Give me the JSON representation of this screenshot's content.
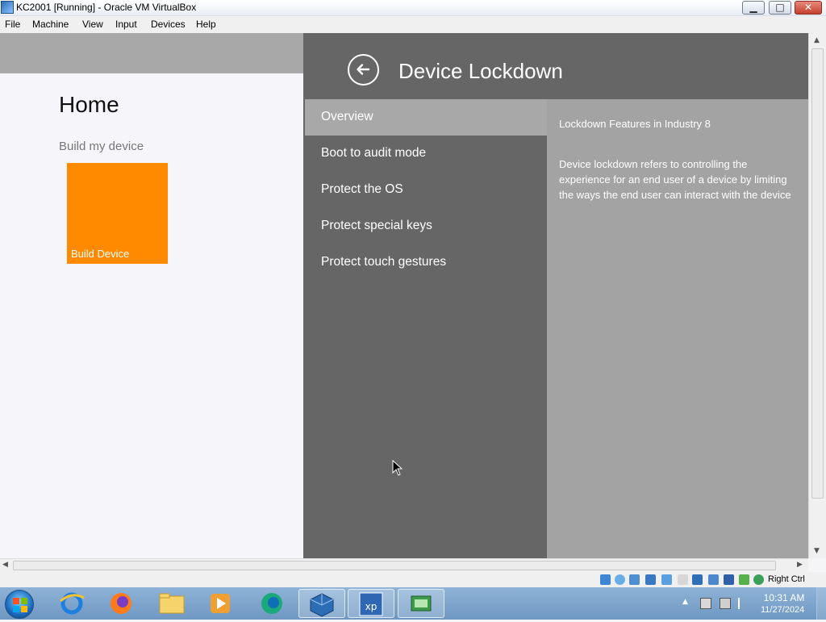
{
  "window": {
    "title": "KC2001 [Running] - Oracle VM VirtualBox",
    "controls": {
      "minimize": "▁",
      "maximize": "□",
      "close": "✕"
    }
  },
  "menu": [
    "File",
    "Machine",
    "View",
    "Input",
    "Devices",
    "Help"
  ],
  "guest": {
    "home": {
      "title": "Home",
      "subtitle": "Build my device",
      "tile": {
        "label": "Build Device",
        "color": "#ff8a00"
      }
    },
    "panel": {
      "title": "Device Lockdown",
      "nav": [
        "Overview",
        "Boot to audit mode",
        "Protect the OS",
        "Protect special keys",
        "Protect touch gestures"
      ],
      "active_nav": "Overview",
      "content_heading": "Lockdown Features in Industry 8",
      "content_lines": [
        "Device lockdown refers to controlling the",
        "experience for an end user of a device by limiting",
        "the ways the end user can interact with the device"
      ]
    }
  },
  "statusbar": {
    "host_key": "Right Ctrl"
  },
  "taskbar": {
    "icons": [
      "windows-start-icon",
      "internet-explorer-icon",
      "firefox-icon",
      "file-explorer-icon",
      "media-player-icon",
      "edge-icon",
      "virtualbox-icon",
      "windows-xp-vm-icon",
      "network-app-icon"
    ],
    "clock": {
      "time": "10:31 AM",
      "date": "11/27/2024"
    }
  },
  "colors": {
    "panel": "#666666",
    "active_nav": "#a8a8a8",
    "content": "#a3a3a3",
    "accent_tile": "#ff8a00"
  }
}
